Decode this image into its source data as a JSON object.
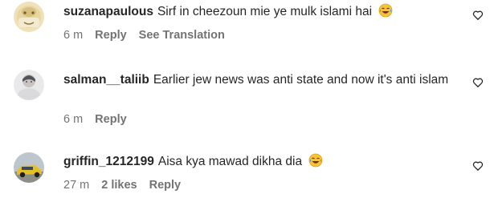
{
  "comments": [
    {
      "username": "suzanapaulous",
      "text": "Sirf in cheezoun mie ye mulk islami hai",
      "emoji": "laughing-tears-emoji",
      "time": "6 m",
      "reply_label": "Reply",
      "translate_label": "See Translation"
    },
    {
      "username": "salman__taliib",
      "text": "Earlier jew news was anti state and now it's anti islam",
      "time": "6 m",
      "reply_label": "Reply"
    },
    {
      "username": "griffin_1212199",
      "text": "Aisa kya mawad dikha dia",
      "emoji": "laughing-tears-emoji",
      "time": "27 m",
      "likes": "2 likes",
      "reply_label": "Reply"
    }
  ],
  "icons": {
    "like": "heart-outline-icon"
  },
  "colors": {
    "primary_text": "#262626",
    "secondary_text": "#737373",
    "background": "#ffffff"
  }
}
